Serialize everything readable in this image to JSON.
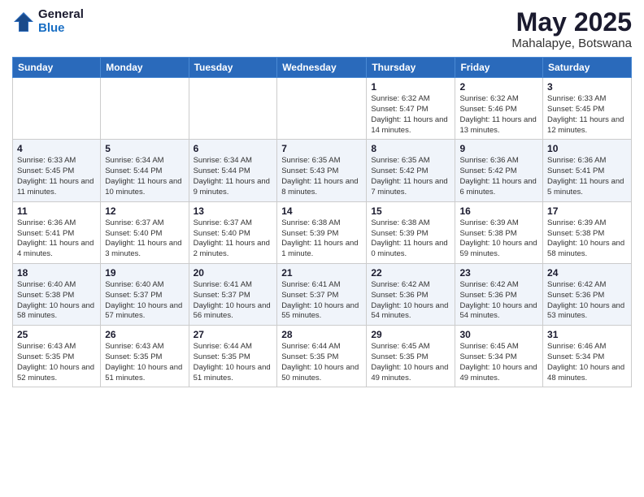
{
  "logo": {
    "general": "General",
    "blue": "Blue"
  },
  "title": "May 2025",
  "subtitle": "Mahalapye, Botswana",
  "days_of_week": [
    "Sunday",
    "Monday",
    "Tuesday",
    "Wednesday",
    "Thursday",
    "Friday",
    "Saturday"
  ],
  "weeks": [
    [
      {
        "day": "",
        "info": ""
      },
      {
        "day": "",
        "info": ""
      },
      {
        "day": "",
        "info": ""
      },
      {
        "day": "",
        "info": ""
      },
      {
        "day": "1",
        "info": "Sunrise: 6:32 AM\nSunset: 5:47 PM\nDaylight: 11 hours and 14 minutes."
      },
      {
        "day": "2",
        "info": "Sunrise: 6:32 AM\nSunset: 5:46 PM\nDaylight: 11 hours and 13 minutes."
      },
      {
        "day": "3",
        "info": "Sunrise: 6:33 AM\nSunset: 5:45 PM\nDaylight: 11 hours and 12 minutes."
      }
    ],
    [
      {
        "day": "4",
        "info": "Sunrise: 6:33 AM\nSunset: 5:45 PM\nDaylight: 11 hours and 11 minutes."
      },
      {
        "day": "5",
        "info": "Sunrise: 6:34 AM\nSunset: 5:44 PM\nDaylight: 11 hours and 10 minutes."
      },
      {
        "day": "6",
        "info": "Sunrise: 6:34 AM\nSunset: 5:44 PM\nDaylight: 11 hours and 9 minutes."
      },
      {
        "day": "7",
        "info": "Sunrise: 6:35 AM\nSunset: 5:43 PM\nDaylight: 11 hours and 8 minutes."
      },
      {
        "day": "8",
        "info": "Sunrise: 6:35 AM\nSunset: 5:42 PM\nDaylight: 11 hours and 7 minutes."
      },
      {
        "day": "9",
        "info": "Sunrise: 6:36 AM\nSunset: 5:42 PM\nDaylight: 11 hours and 6 minutes."
      },
      {
        "day": "10",
        "info": "Sunrise: 6:36 AM\nSunset: 5:41 PM\nDaylight: 11 hours and 5 minutes."
      }
    ],
    [
      {
        "day": "11",
        "info": "Sunrise: 6:36 AM\nSunset: 5:41 PM\nDaylight: 11 hours and 4 minutes."
      },
      {
        "day": "12",
        "info": "Sunrise: 6:37 AM\nSunset: 5:40 PM\nDaylight: 11 hours and 3 minutes."
      },
      {
        "day": "13",
        "info": "Sunrise: 6:37 AM\nSunset: 5:40 PM\nDaylight: 11 hours and 2 minutes."
      },
      {
        "day": "14",
        "info": "Sunrise: 6:38 AM\nSunset: 5:39 PM\nDaylight: 11 hours and 1 minute."
      },
      {
        "day": "15",
        "info": "Sunrise: 6:38 AM\nSunset: 5:39 PM\nDaylight: 11 hours and 0 minutes."
      },
      {
        "day": "16",
        "info": "Sunrise: 6:39 AM\nSunset: 5:38 PM\nDaylight: 10 hours and 59 minutes."
      },
      {
        "day": "17",
        "info": "Sunrise: 6:39 AM\nSunset: 5:38 PM\nDaylight: 10 hours and 58 minutes."
      }
    ],
    [
      {
        "day": "18",
        "info": "Sunrise: 6:40 AM\nSunset: 5:38 PM\nDaylight: 10 hours and 58 minutes."
      },
      {
        "day": "19",
        "info": "Sunrise: 6:40 AM\nSunset: 5:37 PM\nDaylight: 10 hours and 57 minutes."
      },
      {
        "day": "20",
        "info": "Sunrise: 6:41 AM\nSunset: 5:37 PM\nDaylight: 10 hours and 56 minutes."
      },
      {
        "day": "21",
        "info": "Sunrise: 6:41 AM\nSunset: 5:37 PM\nDaylight: 10 hours and 55 minutes."
      },
      {
        "day": "22",
        "info": "Sunrise: 6:42 AM\nSunset: 5:36 PM\nDaylight: 10 hours and 54 minutes."
      },
      {
        "day": "23",
        "info": "Sunrise: 6:42 AM\nSunset: 5:36 PM\nDaylight: 10 hours and 54 minutes."
      },
      {
        "day": "24",
        "info": "Sunrise: 6:42 AM\nSunset: 5:36 PM\nDaylight: 10 hours and 53 minutes."
      }
    ],
    [
      {
        "day": "25",
        "info": "Sunrise: 6:43 AM\nSunset: 5:35 PM\nDaylight: 10 hours and 52 minutes."
      },
      {
        "day": "26",
        "info": "Sunrise: 6:43 AM\nSunset: 5:35 PM\nDaylight: 10 hours and 51 minutes."
      },
      {
        "day": "27",
        "info": "Sunrise: 6:44 AM\nSunset: 5:35 PM\nDaylight: 10 hours and 51 minutes."
      },
      {
        "day": "28",
        "info": "Sunrise: 6:44 AM\nSunset: 5:35 PM\nDaylight: 10 hours and 50 minutes."
      },
      {
        "day": "29",
        "info": "Sunrise: 6:45 AM\nSunset: 5:35 PM\nDaylight: 10 hours and 49 minutes."
      },
      {
        "day": "30",
        "info": "Sunrise: 6:45 AM\nSunset: 5:34 PM\nDaylight: 10 hours and 49 minutes."
      },
      {
        "day": "31",
        "info": "Sunrise: 6:46 AM\nSunset: 5:34 PM\nDaylight: 10 hours and 48 minutes."
      }
    ]
  ]
}
